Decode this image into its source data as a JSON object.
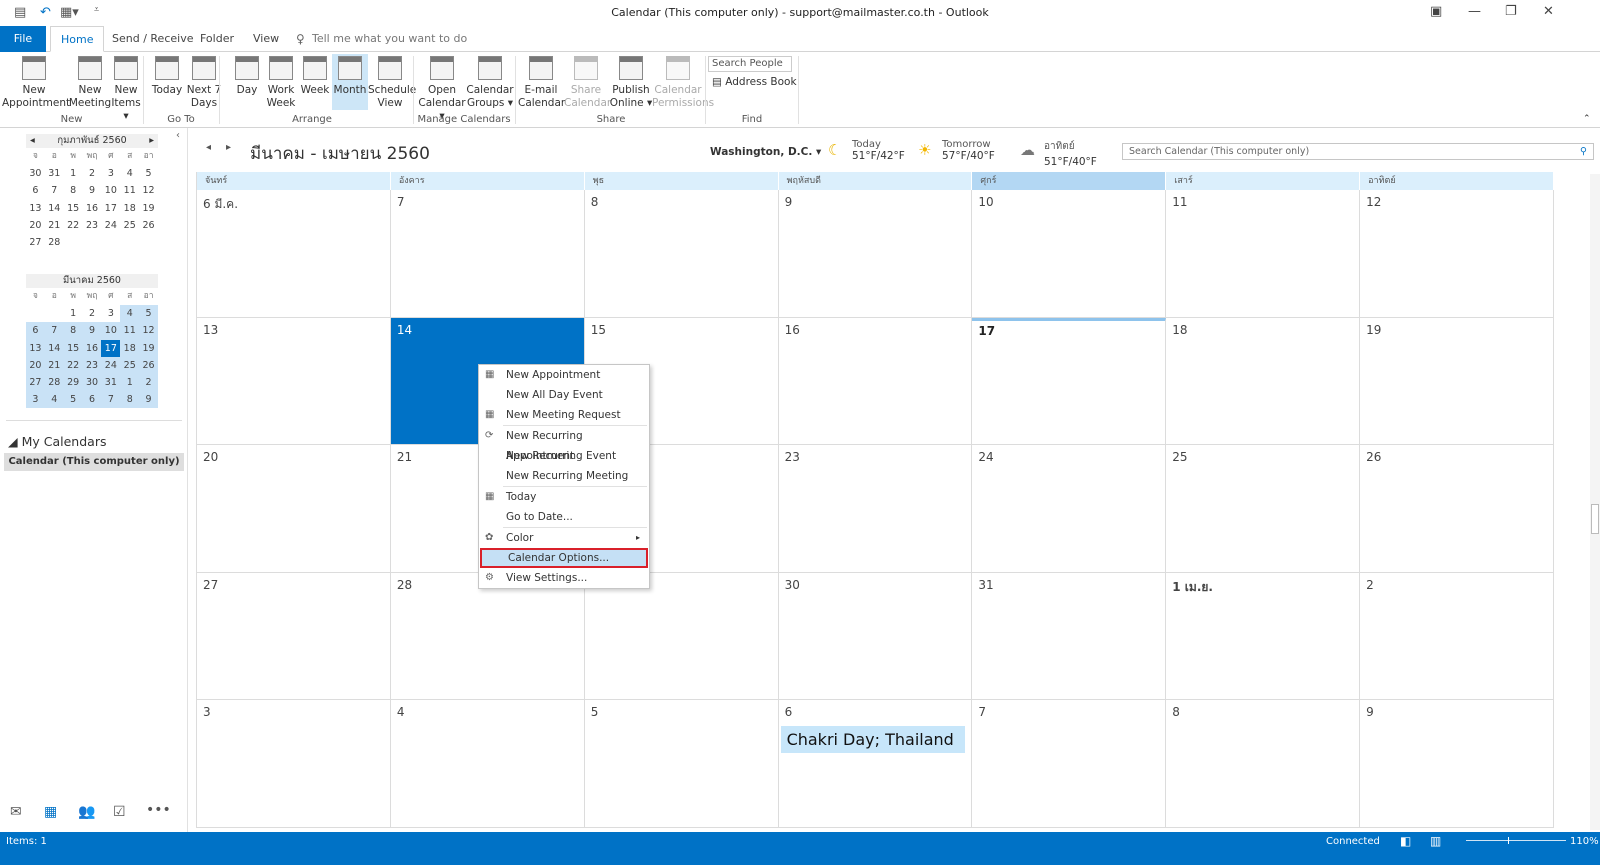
{
  "window": {
    "title": "Calendar (This computer only) - support@mailmaster.co.th  -  Outlook"
  },
  "tabs": [
    "File",
    "Home",
    "Send / Receive",
    "Folder",
    "View"
  ],
  "tell_me": "Tell me what you want to do",
  "ribbon": {
    "buttons": [
      {
        "id": "new-appointment",
        "l1": "New",
        "l2": "Appointment"
      },
      {
        "id": "new-meeting",
        "l1": "New",
        "l2": "Meeting"
      },
      {
        "id": "new-items",
        "l1": "New",
        "l2": "Items ▾"
      },
      {
        "id": "today",
        "l1": "Today",
        "l2": ""
      },
      {
        "id": "next-7-days",
        "l1": "Next 7",
        "l2": "Days"
      },
      {
        "id": "day",
        "l1": "Day",
        "l2": ""
      },
      {
        "id": "work-week",
        "l1": "Work",
        "l2": "Week"
      },
      {
        "id": "week",
        "l1": "Week",
        "l2": ""
      },
      {
        "id": "month",
        "l1": "Month",
        "l2": "",
        "selected": true
      },
      {
        "id": "schedule-view",
        "l1": "Schedule",
        "l2": "View"
      },
      {
        "id": "open-calendar",
        "l1": "Open",
        "l2": "Calendar ▾"
      },
      {
        "id": "calendar-groups",
        "l1": "Calendar",
        "l2": "Groups ▾"
      },
      {
        "id": "email-calendar",
        "l1": "E-mail",
        "l2": "Calendar"
      },
      {
        "id": "share-calendar",
        "l1": "Share",
        "l2": "Calendar",
        "disabled": true
      },
      {
        "id": "publish-online",
        "l1": "Publish",
        "l2": "Online ▾"
      },
      {
        "id": "calendar-permissions",
        "l1": "Calendar",
        "l2": "Permissions",
        "disabled": true
      }
    ],
    "groups": [
      "New",
      "Go To",
      "Arrange",
      "Manage Calendars",
      "Share",
      "Find"
    ],
    "search_people": "Search People",
    "address_book": "Address Book"
  },
  "mini_calendars": [
    {
      "title": "กุมภาพันธ์ 2560",
      "days": [
        "จ",
        "อ",
        "พ",
        "พฤ",
        "ศ",
        "ส",
        "อา"
      ],
      "dates": [
        "30",
        "31",
        "1",
        "2",
        "3",
        "4",
        "5",
        "6",
        "7",
        "8",
        "9",
        "10",
        "11",
        "12",
        "13",
        "14",
        "15",
        "16",
        "17",
        "18",
        "19",
        "20",
        "21",
        "22",
        "23",
        "24",
        "25",
        "26",
        "27",
        "28"
      ]
    },
    {
      "title": "มีนาคม 2560",
      "days": [
        "จ",
        "อ",
        "พ",
        "พฤ",
        "ศ",
        "ส",
        "อา"
      ],
      "dates": [
        "",
        "",
        "1",
        "2",
        "3",
        "4",
        "5",
        "6",
        "7",
        "8",
        "9",
        "10",
        "11",
        "12",
        "13",
        "14",
        "15",
        "16",
        "17",
        "18",
        "19",
        "20",
        "21",
        "22",
        "23",
        "24",
        "25",
        "26",
        "27",
        "28",
        "29",
        "30",
        "31",
        "1",
        "2",
        "3",
        "4",
        "5",
        "6",
        "7",
        "8",
        "9"
      ],
      "today": "17"
    }
  ],
  "folders": {
    "header": "My Calendars",
    "selected": "Calendar (This computer only)"
  },
  "calendar": {
    "range_title": "มีนาคม - เมษายน 2560",
    "location": "Washington, D.C.",
    "weather": [
      {
        "label": "Today",
        "temp": "51°F/42°F",
        "icon": "moon-icon"
      },
      {
        "label": "Tomorrow",
        "temp": "57°F/40°F",
        "icon": "sun-cloud-icon"
      },
      {
        "label": "อาทิตย์",
        "temp": "51°F/40°F",
        "icon": "cloud-icon"
      }
    ],
    "search_placeholder": "Search Calendar (This computer only)",
    "weekdays": [
      "จันทร์",
      "อังคาร",
      "พุธ",
      "พฤหัสบดี",
      "ศุกร์",
      "เสาร์",
      "อาทิตย์"
    ],
    "today_column": 4,
    "weeks": [
      [
        "6 มี.ค.",
        "7",
        "8",
        "9",
        "10",
        "11",
        "12"
      ],
      [
        "13",
        "14",
        "15",
        "16",
        "17",
        "18",
        "19"
      ],
      [
        "20",
        "21",
        "22",
        "23",
        "24",
        "25",
        "26"
      ],
      [
        "27",
        "28",
        "29",
        "30",
        "31",
        "1 เม.ย.",
        "2"
      ],
      [
        "3",
        "4",
        "5",
        "6",
        "7",
        "8",
        "9"
      ]
    ],
    "selected_cell": "14",
    "today_cell": "17",
    "event": {
      "title": "Chakri Day; Thailand",
      "date": "6"
    }
  },
  "context_menu": [
    {
      "label": "New Appointment",
      "icon": "calendar-icon"
    },
    {
      "label": "New All Day Event"
    },
    {
      "label": "New Meeting Request",
      "icon": "meeting-icon",
      "sep_after": true
    },
    {
      "label": "New Recurring Appointment",
      "icon": "recurring-icon"
    },
    {
      "label": "New Recurring Event"
    },
    {
      "label": "New Recurring Meeting",
      "sep_after": true
    },
    {
      "label": "Today",
      "icon": "today-icon"
    },
    {
      "label": "Go to Date...",
      "sep_after": true
    },
    {
      "label": "Color",
      "icon": "color-palette-icon",
      "submenu": true
    },
    {
      "label": "Calendar Options...",
      "highlighted": true
    },
    {
      "label": "View Settings...",
      "icon": "gear-icon"
    }
  ],
  "status": {
    "items": "Items: 1",
    "connection": "Connected",
    "zoom": "110%"
  },
  "colors": {
    "accent": "#0072c6",
    "header": "#dbeffc",
    "today_header": "#b3d7f3",
    "highlight_border": "#d9202a"
  }
}
